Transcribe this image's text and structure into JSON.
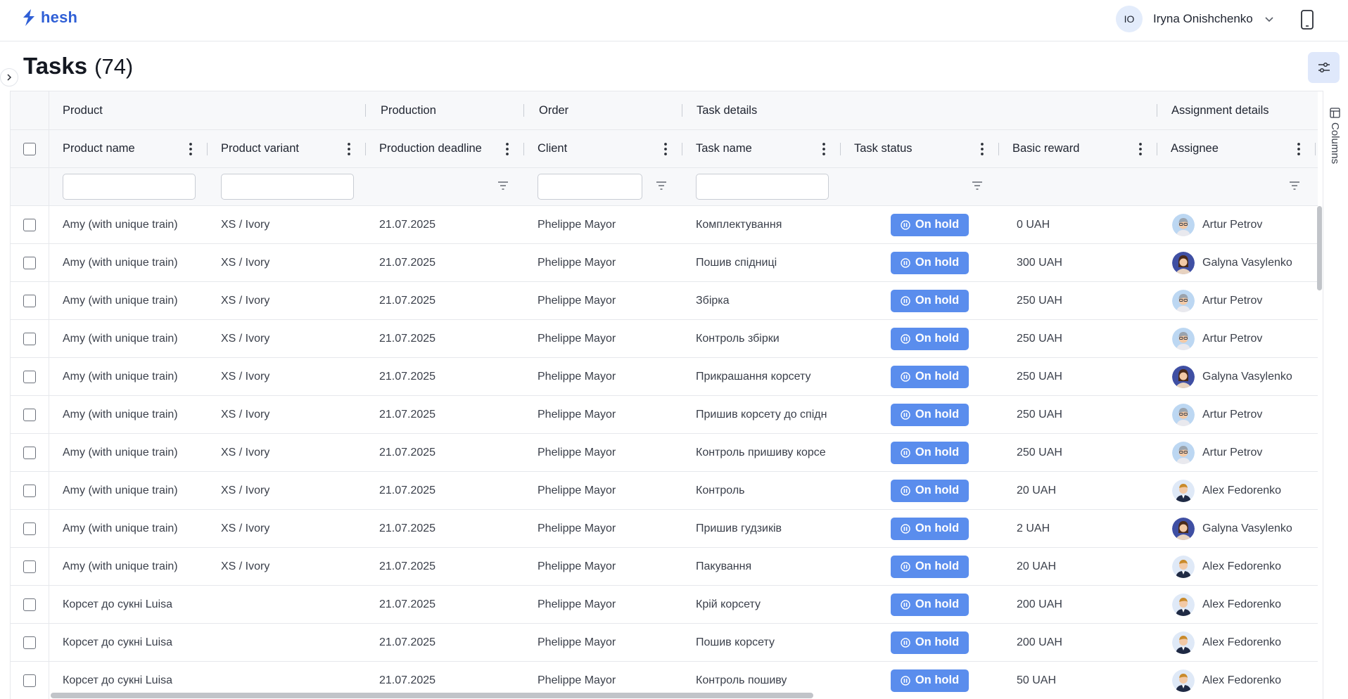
{
  "app": {
    "name": "hesh",
    "brand_color": "#2f5fd6"
  },
  "user": {
    "initials": "IO",
    "name": "Iryna Onishchenko"
  },
  "page": {
    "title": "Tasks",
    "count": "(74)"
  },
  "groups": [
    {
      "label": "",
      "key": "select"
    },
    {
      "label": "Product"
    },
    {
      "label": "Production"
    },
    {
      "label": "Order"
    },
    {
      "label": "Task details"
    },
    {
      "label": "Assignment details"
    }
  ],
  "columns": [
    {
      "key": "product_name",
      "label": "Product name"
    },
    {
      "key": "product_variant",
      "label": "Product variant"
    },
    {
      "key": "production_deadline",
      "label": "Production deadline"
    },
    {
      "key": "client",
      "label": "Client"
    },
    {
      "key": "task_name",
      "label": "Task name"
    },
    {
      "key": "task_status",
      "label": "Task status"
    },
    {
      "key": "basic_reward",
      "label": "Basic reward"
    },
    {
      "key": "assignee",
      "label": "Assignee"
    }
  ],
  "status_color": "#5a8ded",
  "rows": [
    {
      "product_name": "Amy (with unique train)",
      "product_variant": "XS / Ivory",
      "production_deadline": "21.07.2025",
      "client": "Phelippe Mayor",
      "task_name": "Комплектування",
      "task_status": "On hold",
      "basic_reward": "0 UAH",
      "assignee": "Artur Petrov",
      "avatar": "man-glasses"
    },
    {
      "product_name": "Amy (with unique train)",
      "product_variant": "XS / Ivory",
      "production_deadline": "21.07.2025",
      "client": "Phelippe Mayor",
      "task_name": "Пошив спідниці",
      "task_status": "On hold",
      "basic_reward": "300 UAH",
      "assignee": "Galyna Vasylenko",
      "avatar": "woman"
    },
    {
      "product_name": "Amy (with unique train)",
      "product_variant": "XS / Ivory",
      "production_deadline": "21.07.2025",
      "client": "Phelippe Mayor",
      "task_name": "Збірка",
      "task_status": "On hold",
      "basic_reward": "250 UAH",
      "assignee": "Artur Petrov",
      "avatar": "man-glasses"
    },
    {
      "product_name": "Amy (with unique train)",
      "product_variant": "XS / Ivory",
      "production_deadline": "21.07.2025",
      "client": "Phelippe Mayor",
      "task_name": "Контроль збірки",
      "task_status": "On hold",
      "basic_reward": "250 UAH",
      "assignee": "Artur Petrov",
      "avatar": "man-glasses"
    },
    {
      "product_name": "Amy (with unique train)",
      "product_variant": "XS / Ivory",
      "production_deadline": "21.07.2025",
      "client": "Phelippe Mayor",
      "task_name": "Прикрашання корсету",
      "task_status": "On hold",
      "basic_reward": "250 UAH",
      "assignee": "Galyna Vasylenko",
      "avatar": "woman"
    },
    {
      "product_name": "Amy (with unique train)",
      "product_variant": "XS / Ivory",
      "production_deadline": "21.07.2025",
      "client": "Phelippe Mayor",
      "task_name": "Пришив корсету до спідн",
      "task_status": "On hold",
      "basic_reward": "250 UAH",
      "assignee": "Artur Petrov",
      "avatar": "man-glasses"
    },
    {
      "product_name": "Amy (with unique train)",
      "product_variant": "XS / Ivory",
      "production_deadline": "21.07.2025",
      "client": "Phelippe Mayor",
      "task_name": "Контроль пришиву корсе",
      "task_status": "On hold",
      "basic_reward": "250 UAH",
      "assignee": "Artur Petrov",
      "avatar": "man-glasses"
    },
    {
      "product_name": "Amy (with unique train)",
      "product_variant": "XS / Ivory",
      "production_deadline": "21.07.2025",
      "client": "Phelippe Mayor",
      "task_name": "Контроль",
      "task_status": "On hold",
      "basic_reward": "20 UAH",
      "assignee": "Alex Fedorenko",
      "avatar": "man-suit"
    },
    {
      "product_name": "Amy (with unique train)",
      "product_variant": "XS / Ivory",
      "production_deadline": "21.07.2025",
      "client": "Phelippe Mayor",
      "task_name": "Пришив гудзиків",
      "task_status": "On hold",
      "basic_reward": "2 UAH",
      "assignee": "Galyna Vasylenko",
      "avatar": "woman"
    },
    {
      "product_name": "Amy (with unique train)",
      "product_variant": "XS / Ivory",
      "production_deadline": "21.07.2025",
      "client": "Phelippe Mayor",
      "task_name": "Пакування",
      "task_status": "On hold",
      "basic_reward": "20 UAH",
      "assignee": "Alex Fedorenko",
      "avatar": "man-suit"
    },
    {
      "product_name": "Корсет до сукні Luisa",
      "product_variant": "",
      "production_deadline": "21.07.2025",
      "client": "Phelippe Mayor",
      "task_name": "Крій корсету",
      "task_status": "On hold",
      "basic_reward": "200 UAH",
      "assignee": "Alex Fedorenko",
      "avatar": "man-suit"
    },
    {
      "product_name": "Корсет до сукні Luisa",
      "product_variant": "",
      "production_deadline": "21.07.2025",
      "client": "Phelippe Mayor",
      "task_name": "Пошив корсету",
      "task_status": "On hold",
      "basic_reward": "200 UAH",
      "assignee": "Alex Fedorenko",
      "avatar": "man-suit"
    },
    {
      "product_name": "Корсет до сукні Luisa",
      "product_variant": "",
      "production_deadline": "21.07.2025",
      "client": "Phelippe Mayor",
      "task_name": "Контроль пошиву",
      "task_status": "On hold",
      "basic_reward": "50 UAH",
      "assignee": "Alex Fedorenko",
      "avatar": "man-suit"
    }
  ],
  "side_panel": {
    "columns_label": "Columns"
  },
  "icons": {
    "logo": "hesh-bolt-logo",
    "user_menu": "chevron-down-icon",
    "device": "mobile-device-icon",
    "sidebar": "chevron-right-icon",
    "filters": "sliders-icon",
    "column_menu": "kebab-icon",
    "column_filter": "funnel-icon",
    "status": "pause-icon",
    "columns_panel": "table-columns-icon"
  }
}
